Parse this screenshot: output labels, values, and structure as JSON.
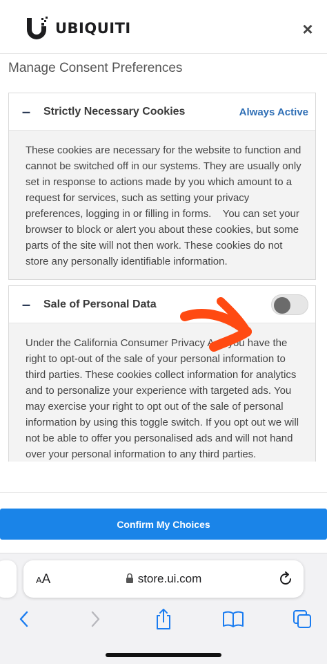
{
  "header": {
    "brand": "UBIQUITI",
    "close_label": "×"
  },
  "title": "Manage Consent Preferences",
  "sections": [
    {
      "toggle_symbol": "–",
      "title": "Strictly Necessary Cookies",
      "status": "Always Active",
      "body": "These cookies are necessary for the website to function and cannot be switched off in our systems. They are usually only set in response to actions made by you which amount to a request for services, such as setting your privacy preferences, logging in or filling in forms.    You can set your browser to block or alert you about these cookies, but some parts of the site will not then work. These cookies do not store any personally identifiable information."
    },
    {
      "toggle_symbol": "–",
      "title": "Sale of Personal Data",
      "toggle_state": "off",
      "body": "Under the California Consumer Privacy Act, you have the right to opt-out of the sale of your personal information to third parties. These cookies collect information for analytics and to personalize your experience with targeted ads. You may exercise your right to opt out of the sale of personal information by using this toggle switch. If you opt out we will not be able to offer you personalised ads and will not hand over your personal information to any third parties."
    }
  ],
  "confirm_label": "Confirm My Choices",
  "browser": {
    "aa_large": "A",
    "aa_small": "A",
    "url": "store.ui.com"
  },
  "colors": {
    "accent": "#1a84e8",
    "always_active": "#2e6eb5",
    "annotation": "#ff4a12"
  },
  "icons": [
    "close-icon",
    "minus-icon",
    "lock-icon",
    "reload-icon",
    "back-icon",
    "forward-icon",
    "share-icon",
    "bookmarks-icon",
    "tabs-icon"
  ]
}
